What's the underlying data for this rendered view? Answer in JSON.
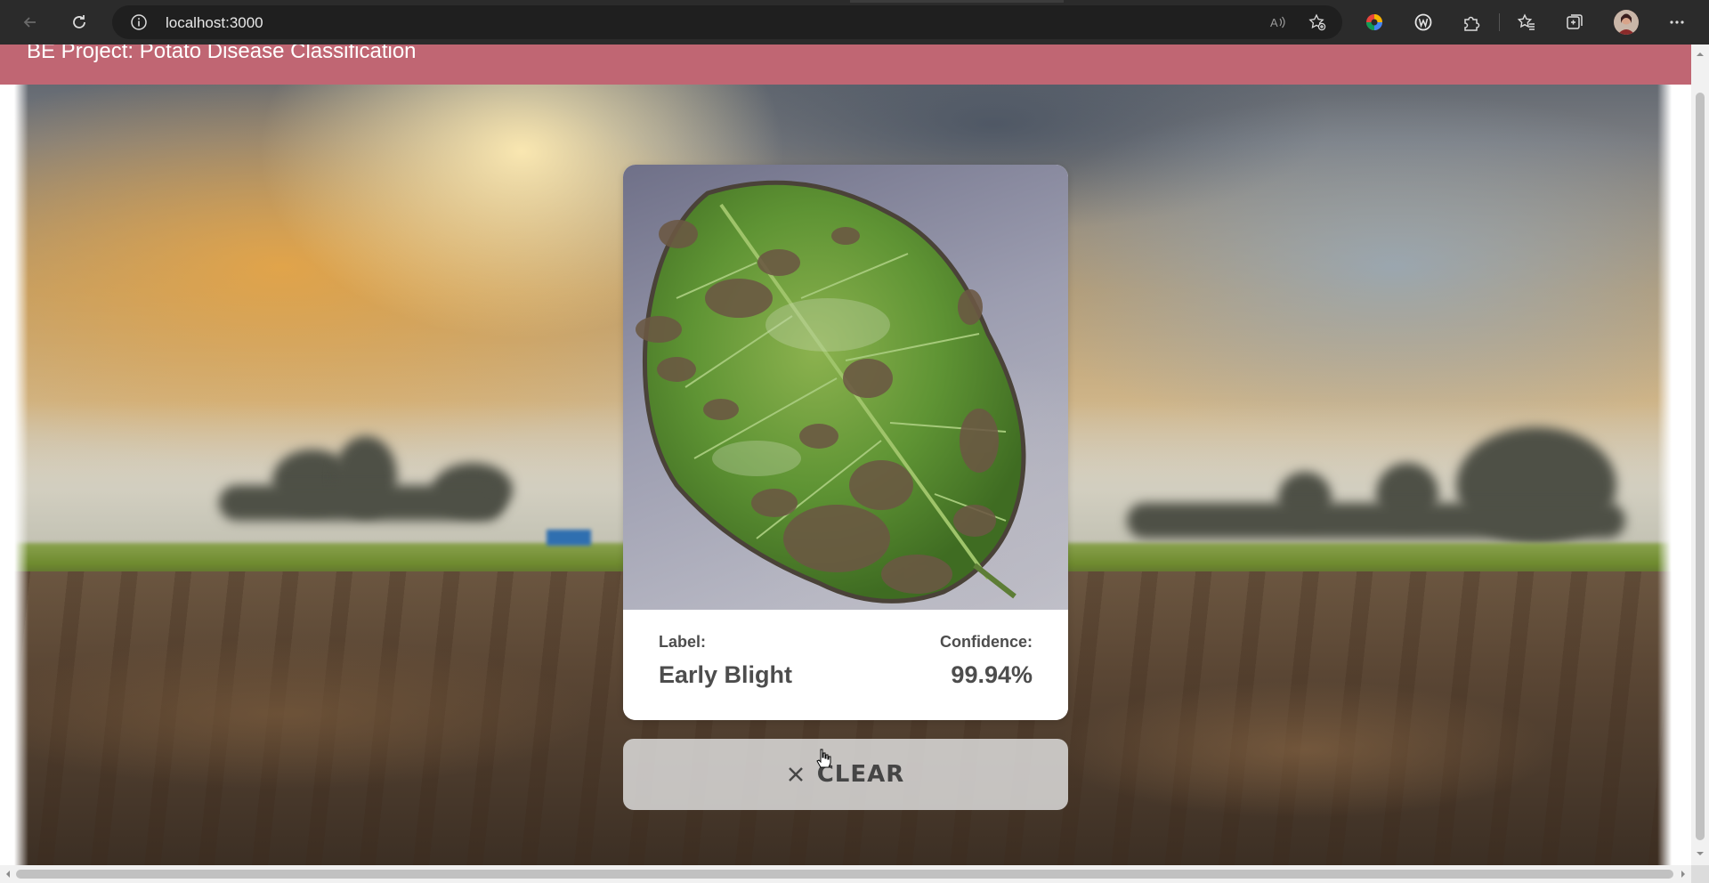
{
  "browser": {
    "url": "localhost:3000",
    "icons": [
      "back-icon",
      "refresh-icon",
      "site-info-icon",
      "read-aloud-icon",
      "add-favorite-icon",
      "color-extension-icon",
      "wallet-extension-icon",
      "extensions-icon",
      "favorites-icon",
      "collections-icon",
      "profile-avatar",
      "more-menu-icon"
    ]
  },
  "header": {
    "title": "BE Project: Potato Disease Classification",
    "background_color": "#c06673"
  },
  "result": {
    "label_caption": "Label:",
    "label_value": "Early Blight",
    "confidence_caption": "Confidence:",
    "confidence_value": "99.94%"
  },
  "clear_button": {
    "icon": "close-icon",
    "label": "CLEAR"
  }
}
